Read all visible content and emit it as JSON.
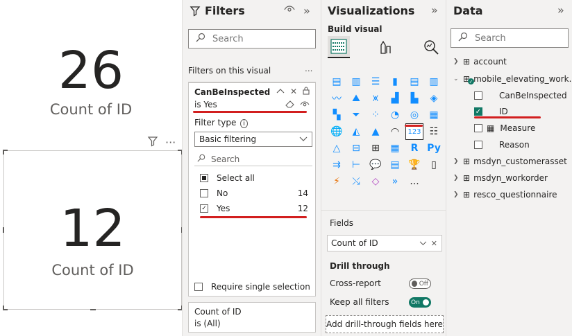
{
  "canvas": {
    "card_top": {
      "value": "26",
      "label": "Count of ID"
    },
    "card_selected": {
      "value": "12",
      "label": "Count of ID"
    }
  },
  "filters": {
    "title": "Filters",
    "search_placeholder": "Search",
    "section_label": "Filters on this visual",
    "more": "...",
    "card": {
      "field": "CanBeInspected",
      "condition": "is Yes",
      "filter_type_label": "Filter type",
      "filter_type_value": "Basic filtering",
      "search_placeholder": "Search",
      "options": [
        {
          "label": "Select all",
          "count": ""
        },
        {
          "label": "No",
          "count": "14"
        },
        {
          "label": "Yes",
          "count": "12"
        }
      ],
      "require_single": "Require single selection"
    },
    "card2": {
      "field": "Count of ID",
      "condition": "is (All)"
    }
  },
  "viz": {
    "title": "Visualizations",
    "build_label": "Build visual",
    "fields_label": "Fields",
    "field_well": "Count of ID",
    "drill_label": "Drill through",
    "cross_report": "Cross-report",
    "cross_report_state": "Off",
    "keep_filters": "Keep all filters",
    "keep_filters_state": "On",
    "drop_zone": "Add drill-through fields here",
    "more": "..."
  },
  "data": {
    "title": "Data",
    "search_placeholder": "Search",
    "tables": [
      {
        "name": "account"
      },
      {
        "name": "mobile_elevating_work..."
      },
      {
        "name": "msdyn_customerasset"
      },
      {
        "name": "msdyn_workorder"
      },
      {
        "name": "resco_questionnaire"
      }
    ],
    "fields": [
      {
        "name": "CanBeInspected"
      },
      {
        "name": "ID"
      },
      {
        "name": "Measure"
      },
      {
        "name": "Reason"
      }
    ]
  },
  "colors": {
    "accent_teal": "#117865",
    "highlight_red": "#d21f1f",
    "viz_blue": "#118dff"
  }
}
